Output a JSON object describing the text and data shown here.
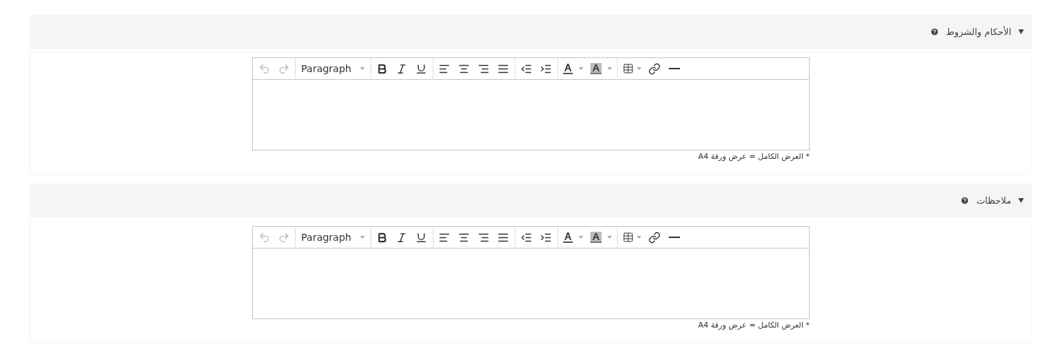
{
  "sections": [
    {
      "title": "الأحكام والشروط",
      "expanded": true,
      "editor": {
        "toolbar": [
          {
            "kind": "undo",
            "disabled": true
          },
          {
            "kind": "redo",
            "disabled": true
          },
          {
            "kind": "format",
            "label": "Paragraph",
            "disabled": false
          },
          {
            "kind": "bold",
            "disabled": false
          },
          {
            "kind": "italic",
            "disabled": false
          },
          {
            "kind": "underline",
            "disabled": false
          },
          {
            "kind": "align-left",
            "disabled": false
          },
          {
            "kind": "align-center",
            "disabled": false
          },
          {
            "kind": "align-right",
            "disabled": false
          },
          {
            "kind": "justify",
            "disabled": false
          },
          {
            "kind": "outdent",
            "disabled": false
          },
          {
            "kind": "indent",
            "disabled": false
          },
          {
            "kind": "text-color",
            "disabled": false
          },
          {
            "kind": "background-color",
            "disabled": false
          },
          {
            "kind": "table",
            "disabled": false
          },
          {
            "kind": "link",
            "disabled": false
          },
          {
            "kind": "rule",
            "disabled": false
          }
        ],
        "note": "* العرض الكامل = عرض ورقة A4"
      }
    },
    {
      "title": "ملاحظات",
      "expanded": true,
      "editor": {
        "toolbar": [
          {
            "kind": "undo",
            "disabled": true
          },
          {
            "kind": "redo",
            "disabled": true
          },
          {
            "kind": "format",
            "label": "Paragraph",
            "disabled": false
          },
          {
            "kind": "bold",
            "disabled": false
          },
          {
            "kind": "italic",
            "disabled": false
          },
          {
            "kind": "underline",
            "disabled": false
          },
          {
            "kind": "align-left",
            "disabled": false
          },
          {
            "kind": "align-center",
            "disabled": false
          },
          {
            "kind": "align-right",
            "disabled": false
          },
          {
            "kind": "justify",
            "disabled": false
          },
          {
            "kind": "outdent",
            "disabled": false
          },
          {
            "kind": "indent",
            "disabled": false
          },
          {
            "kind": "text-color",
            "disabled": false
          },
          {
            "kind": "background-color",
            "disabled": false
          },
          {
            "kind": "table",
            "disabled": false
          },
          {
            "kind": "link",
            "disabled": false
          },
          {
            "kind": "rule",
            "disabled": false
          }
        ],
        "note": "* العرض الكامل = عرض ورقة A4"
      }
    }
  ]
}
